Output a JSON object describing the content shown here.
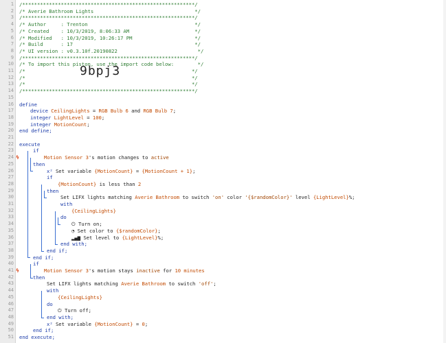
{
  "header": {
    "border": "/**********************************************************/",
    "title_line": "/* Averie Bathroom Lights                                  */",
    "author_line": "/* Author     : Trenton                                    */",
    "created_line": "/* Created    : 10/3/2019, 8:06:33 AM                      */",
    "modified_line": "/* Modified   : 10/3/2019, 10:26:17 PM                     */",
    "build_line": "/* Build      : 17                                         */",
    "ui_line": "/* UI version : v0.3.10f.20190822                           */",
    "import_line": "/* To import this piston, use the import code below:        */",
    "blank_line": "/*                                                        */",
    "import_code": "9bpj3"
  },
  "line_numbers": [
    "1",
    "2",
    "3",
    "4",
    "5",
    "6",
    "7",
    "8",
    "9",
    "10",
    "11",
    "12",
    "13",
    "14",
    "15",
    "16",
    "17",
    "18",
    "19",
    "20",
    "21",
    "22",
    "23",
    "24",
    "25",
    "26",
    "27",
    "28",
    "29",
    "30",
    "31",
    "32",
    "33",
    "34",
    "35",
    "36",
    "37",
    "38",
    "39",
    "40",
    "41",
    "42",
    "43",
    "44",
    "45",
    "46",
    "47",
    "48",
    "49",
    "50",
    "51"
  ],
  "define": {
    "kw_define": "define",
    "device_kw": "device",
    "device_name": "CeilingLights",
    "eq": " = ",
    "bulb6": "RGB Bulb 6",
    "and": " and ",
    "bulb7": "RGB Bulb 7",
    "semi": ";",
    "int_kw": "integer",
    "lightlevel": "LightLevel",
    "eq100": " = ",
    "val100": "100",
    "motioncount": "MotionCount",
    "end_define": "end define;"
  },
  "execute": {
    "kw_execute": "execute",
    "if": "if",
    "then": "then",
    "end_if": "end if;",
    "with": "with",
    "do": "do",
    "end_with": "end with;",
    "end_execute": "end execute;",
    "motion_sensor": "Motion Sensor 3",
    "changes_to": "'s motion changes to ",
    "active": "active",
    "set_variable": "Set variable ",
    "mc_brace": "{MotionCount}",
    "eq_brace": " = ",
    "mc_plus1": "{MotionCount + 1}",
    "semi": ";",
    "less_than": " is less than ",
    "two": "2",
    "set_lifx_1": "Set LIFX lights matching ",
    "averie": "Averie Bathroom",
    "to_switch_on": " to switch ",
    "on_q": "'on'",
    "color_word": " color ",
    "rand_color_q": "'{$randomColor}'",
    "level_word": " level ",
    "ll_brace": "{LightLevel}",
    "pct_semi": "%;",
    "ceiling_brace": "{CeilingLights}",
    "turn_on": "Turn on;",
    "set_color_to": "Set color to ",
    "rand_color": "{$randomColor}",
    "set_level_to": "Set level to ",
    "ll_brace2": "{LightLevel}",
    "stays": "'s motion stays ",
    "inactive": "inactive",
    "for_word": " for ",
    "ten_minutes": "10 minutes",
    "to_switch_off": " to switch ",
    "off_q": "'off'",
    "turn_off": "Turn off;",
    "eq_zero": " = ",
    "zero": "0"
  },
  "icons": {
    "variable": "x²",
    "power": "⏻",
    "palette": "◔",
    "level": "▂▄▆",
    "trigger": "ϟ"
  },
  "colors": {
    "comment": "#2e7d32",
    "keyword": "#1a3aa8",
    "value": "#c24a00",
    "trigger": "#d84315",
    "guide": "#3b6fd1",
    "gutter": "#ececec"
  }
}
